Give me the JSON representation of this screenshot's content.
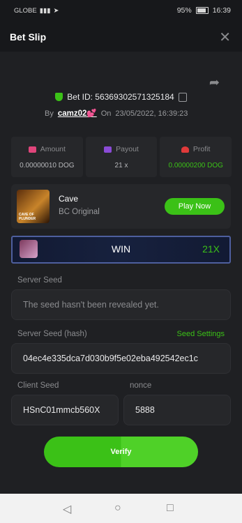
{
  "status_bar": {
    "carrier": "GLOBE",
    "battery": "95%",
    "time": "16:39"
  },
  "header": {
    "title": "Bet Slip",
    "close_icon": "close-icon"
  },
  "bet": {
    "id_label": "Bet ID: 56369302571325184",
    "by_label": "By",
    "user": "camz02💕",
    "on_label": "On",
    "datetime": "23/05/2022, 16:39:23"
  },
  "stats": {
    "amount": {
      "label": "Amount",
      "value": "0.00000010 DOG"
    },
    "payout": {
      "label": "Payout",
      "value": "21 x"
    },
    "profit": {
      "label": "Profit",
      "value": "0.00000200 DOG"
    }
  },
  "game": {
    "name": "Cave",
    "provider": "BC Original",
    "play_label": "Play Now",
    "thumb_text": "CAVE OF PLUNDER"
  },
  "result": {
    "label": "WIN",
    "multiplier": "21X"
  },
  "seeds": {
    "server_seed_label": "Server Seed",
    "server_seed_value": "The seed hasn't been revealed yet.",
    "server_hash_label": "Server Seed (hash)",
    "seed_settings_label": "Seed Settings",
    "server_hash_value": "04ec4e335dca7d030b9f5e02eba492542ec1c",
    "client_seed_label": "Client Seed",
    "client_seed_value": "HSnC01mmcb560X",
    "nonce_label": "nonce",
    "nonce_value": "5888"
  },
  "verify_label": "Verify",
  "colors": {
    "accent": "#3bc117",
    "background": "#17181b",
    "panel": "#1f2023",
    "card": "#26272a"
  }
}
